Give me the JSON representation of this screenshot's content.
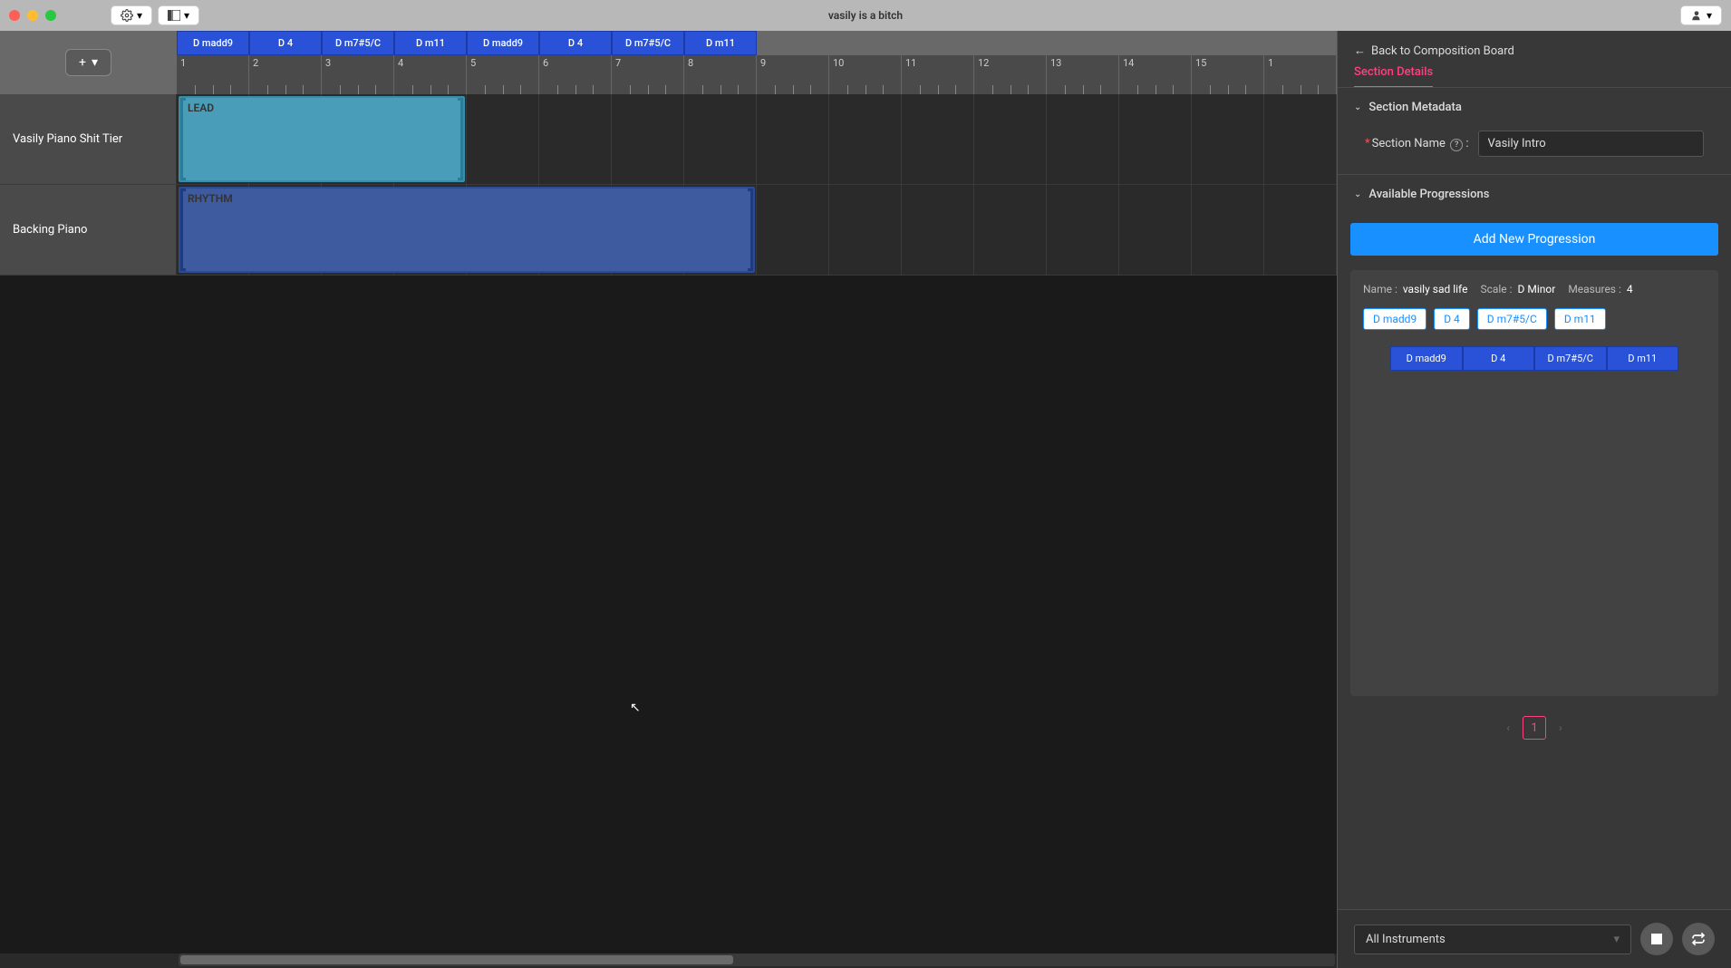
{
  "titlebar": {
    "title": "vasily is a bitch"
  },
  "sidebar": {
    "back_label": "Back to Composition Board",
    "tab_label": "Section Details",
    "metadata_header": "Section Metadata",
    "section_name_label": "Section Name",
    "section_name_value": "Vasily Intro",
    "progressions_header": "Available Progressions",
    "add_progression_label": "Add New Progression",
    "prog": {
      "name_label": "Name :",
      "name_value": "vasily sad life",
      "scale_label": "Scale :",
      "scale_value": "D Minor",
      "measures_label": "Measures :",
      "measures_value": "4",
      "chord_tags": [
        "D madd9",
        "D 4",
        "D m7#5/C",
        "D m11"
      ],
      "chord_bar": [
        "D madd9",
        "D 4",
        "D m7#5/C",
        "D m11"
      ]
    },
    "page_number": "1",
    "instrument_select": "All Instruments"
  },
  "timeline": {
    "chords": [
      "D madd9",
      "D 4",
      "D m7#5/C",
      "D m11",
      "D madd9",
      "D 4",
      "D m7#5/C",
      "D m11"
    ],
    "ruler": [
      "1",
      "2",
      "3",
      "4",
      "5",
      "6",
      "7",
      "8",
      "9",
      "10",
      "11",
      "12",
      "13",
      "14",
      "15",
      "1"
    ],
    "tracks": [
      {
        "name": "Vasily Piano Shit Tier",
        "clip_label": "LEAD",
        "clip_class": "clip-lead"
      },
      {
        "name": "Backing Piano",
        "clip_label": "RHYTHM",
        "clip_class": "clip-rhythm"
      }
    ]
  }
}
